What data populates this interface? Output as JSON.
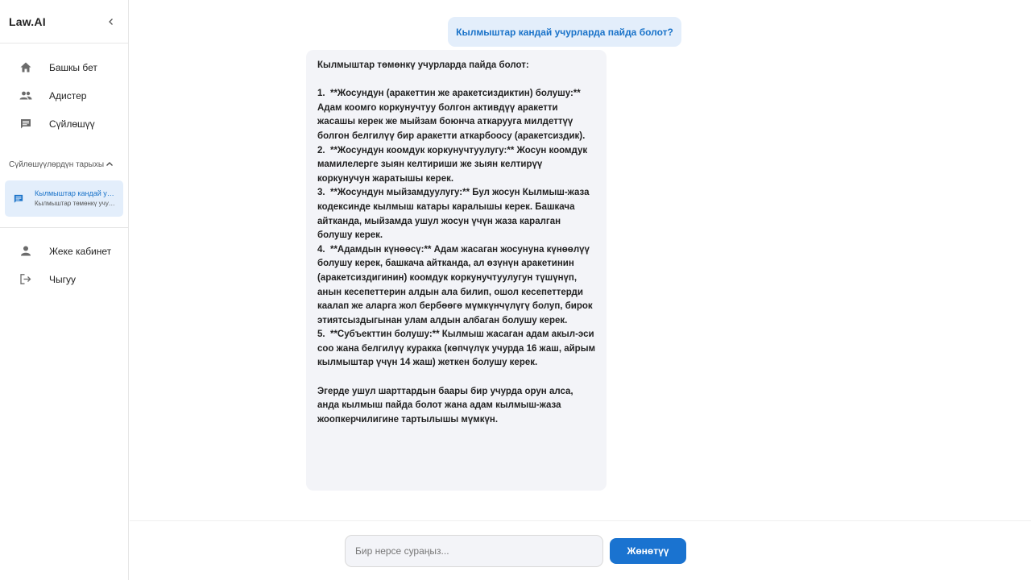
{
  "sidebar": {
    "brand": "Law.AI",
    "nav": [
      {
        "label": "Башкы бет",
        "icon": "home-icon"
      },
      {
        "label": "Адистер",
        "icon": "people-icon"
      },
      {
        "label": "Сүйлөшүү",
        "icon": "chat-icon"
      }
    ],
    "history_header": "Сүйлөшүүлөрдүн тарыхы",
    "history": [
      {
        "title": "Кылмыштар кандай учурларда пайда болот?",
        "subtitle": "Кылмыштар төмөнкү учурларда пайда болот:"
      }
    ],
    "nav2": [
      {
        "label": "Жеке кабинет",
        "icon": "person-icon"
      },
      {
        "label": "Чыгуу",
        "icon": "logout-icon"
      }
    ]
  },
  "chat": {
    "user_message": "Кылмыштар кандай учурларда пайда болот?",
    "bot_message": "Кылмыштар төмөнкү учурларда пайда болот:\n\n1.  **Жосундун (аракеттин же аракетсиздиктин) болушу:** Адам коомго коркунучтуу болгон активдүү аракетти жасашы керек же мыйзам боюнча аткарууга милдеттүү болгон белгилүү бир аракетти аткарбоосу (аракетсиздик).\n2.  **Жосундун коомдук коркунучтуулугу:** Жосун коомдук мамилелерге зыян келтириши же зыян келтирүү коркунучун жаратышы керек.\n3.  **Жосундун мыйзамдуулугу:** Бул жосун Кылмыш-жаза кодексинде кылмыш катары каралышы керек. Башкача айтканда, мыйзамда ушул жосун үчүн жаза каралган болушу керек.\n4.  **Адамдын күнөөсү:** Адам жасаган жосунуна күнөөлүү болушу керек, башкача айтканда, ал өзүнүн аракетинин (аракетсиздигинин) коомдук коркунучтуулугун түшүнүп, анын кесепеттерин алдын ала билип, ошол кесепеттерди каалап же аларга жол бербөөгө мүмкүнчүлүгү болуп, бирок этиятсыздыгынан улам алдын албаган болушу керек.\n5.  **Субъекттин болушу:** Кылмыш жасаган адам акыл-эси соо жана белгилүү куракка (көпчүлүк учурда 16 жаш, айрым кылмыштар үчүн 14 жаш) жеткен болушу керек.\n\nЭгерде ушул шарттардын баары бир учурда орун алса, анда кылмыш пайда болот жана адам кылмыш-жаза жоопкерчилигине тартылышы мүмкүн."
  },
  "composer": {
    "placeholder": "Бир нерсе сураңыз...",
    "value": "",
    "send_label": "Жөнөтүү"
  },
  "colors": {
    "accent": "#1a73d0",
    "bubble_user_bg": "#e3eefb",
    "bubble_bot_bg": "#f3f4f8"
  }
}
